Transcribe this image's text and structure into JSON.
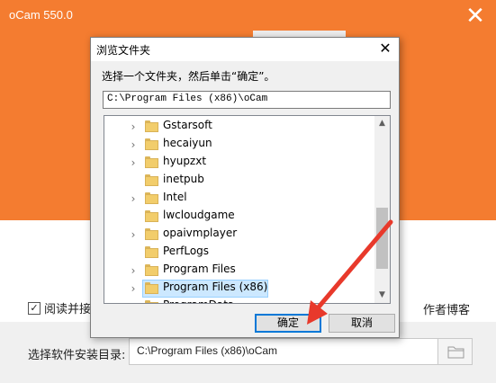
{
  "installer": {
    "title": "oCam 550.0",
    "close_glyph": "✕",
    "agree_label": "阅读并接受",
    "agree_checked": true,
    "blog_link": "作者博客",
    "dir_label": "选择软件安装目录:",
    "dir_value": "C:\\Program Files (x86)\\oCam",
    "browse_icon": "folder-icon"
  },
  "dialog": {
    "title": "浏览文件夹",
    "close_glyph": "✕",
    "prompt": "选择一个文件夹，然后单击“确定”。",
    "path_value": "C:\\Program Files (x86)\\oCam",
    "items": [
      {
        "label": "Gstarsoft",
        "has_children": true
      },
      {
        "label": "hecaiyun",
        "has_children": true
      },
      {
        "label": "hyupzxt",
        "has_children": true
      },
      {
        "label": "inetpub",
        "has_children": false
      },
      {
        "label": "Intel",
        "has_children": true
      },
      {
        "label": "lwcloudgame",
        "has_children": false
      },
      {
        "label": "opaivmplayer",
        "has_children": true
      },
      {
        "label": "PerfLogs",
        "has_children": false
      },
      {
        "label": "Program Files",
        "has_children": true
      },
      {
        "label": "Program Files (x86)",
        "has_children": true,
        "selected": true
      },
      {
        "label": "ProgramData",
        "has_children": true
      }
    ],
    "ok_label": "确定",
    "cancel_label": "取消"
  },
  "colors": {
    "accent": "#f47c30",
    "annotation_arrow": "#e8392b",
    "selection": "#cce8ff"
  }
}
